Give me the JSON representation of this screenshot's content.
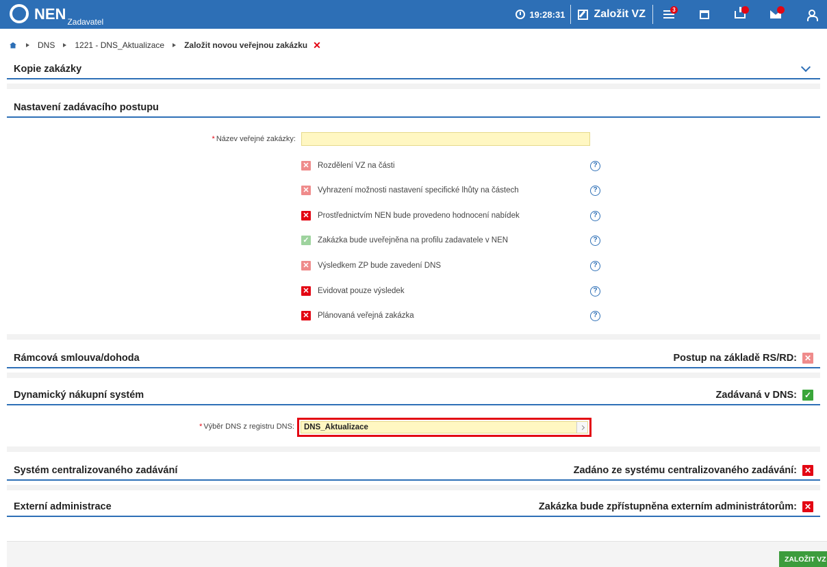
{
  "app": {
    "logo_text": "NEN",
    "logo_sub": "Zadavatel",
    "clock": "19:28:31",
    "create_label": "Založit VZ",
    "tasks_badge": "3"
  },
  "breadcrumb": {
    "item1": "DNS",
    "item2": "1221 - DNS_Aktualizace",
    "current": "Založit novou veřejnou zakázku",
    "close": "✕"
  },
  "sections": {
    "kopie": {
      "title": "Kopie zakázky"
    },
    "nastaveni": {
      "title": "Nastavení zadávacího postupu"
    },
    "ramcova": {
      "title": "Rámcová smlouva/dohoda",
      "right_label": "Postup na základě RS/RD:"
    },
    "dns": {
      "title": "Dynamický nákupní systém",
      "right_label": "Zadávaná v DNS:"
    },
    "centralizovane": {
      "title": "Systém centralizovaného zadávání",
      "right_label": "Zadáno ze systému centralizovaného zadávání:"
    },
    "externi": {
      "title": "Externí administrace",
      "right_label": "Zakázka bude zpřístupněna externím administrátorům:"
    }
  },
  "form": {
    "name_label": "Název veřejné zakázky:",
    "name_value": "",
    "required_mark": "*",
    "dns_label": "Výběr DNS z registru DNS:",
    "dns_value": "DNS_Aktualizace"
  },
  "options": [
    {
      "label": "Rozdělení VZ na části",
      "state": "disabled-unchecked"
    },
    {
      "label": "Vyhrazení možnosti nastavení specifické lhůty na částech",
      "state": "disabled-unchecked"
    },
    {
      "label": "Prostřednictvím NEN bude provedeno hodnocení nabídek",
      "state": "unchecked"
    },
    {
      "label": "Zakázka bude uveřejněna na profilu zadavatele v NEN",
      "state": "disabled-checked"
    },
    {
      "label": "Výsledkem ZP bude zavedení DNS",
      "state": "disabled-unchecked"
    },
    {
      "label": "Evidovat pouze výsledek",
      "state": "unchecked"
    },
    {
      "label": "Plánovaná veřejná zakázka",
      "state": "unchecked"
    }
  ],
  "glyphs": {
    "x": "✕",
    "check": "✓",
    "help": "?"
  },
  "footer": {
    "create_button": "ZALOŽIT VZ"
  },
  "colors": {
    "primary": "#2d6fb6",
    "danger": "#e30613",
    "success": "#3c9c3c",
    "input_bg": "#fff7c2"
  }
}
